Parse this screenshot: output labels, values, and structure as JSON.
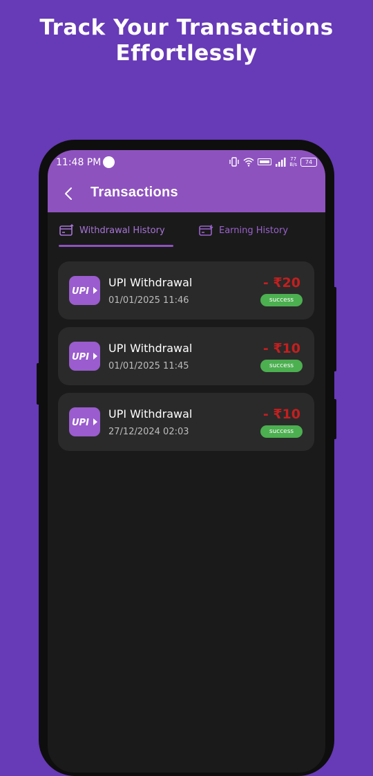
{
  "promo": {
    "line1": "Track Your Transactions",
    "line2": "Effortlessly"
  },
  "status_bar": {
    "time": "11:48 PM",
    "data_speed_top": "77",
    "data_speed_bottom": "B/s",
    "battery": "74",
    "icons": [
      "vibrate-icon",
      "wifi-icon",
      "volte-icon",
      "signal-icon",
      "battery-icon"
    ]
  },
  "appbar": {
    "title": "Transactions",
    "back_icon": "chevron-left-icon"
  },
  "tabs": [
    {
      "label": "Withdrawal History",
      "icon": "withdraw-card-icon",
      "active": true
    },
    {
      "label": "Earning History",
      "icon": "earning-card-icon",
      "active": false
    }
  ],
  "transactions": [
    {
      "title": "UPI Withdrawal",
      "date": "01/01/2025 11:46",
      "amount": "- ₹20",
      "status": "success",
      "logo_text": "UPI"
    },
    {
      "title": "UPI Withdrawal",
      "date": "01/01/2025 11:45",
      "amount": "- ₹10",
      "status": "success",
      "logo_text": "UPI"
    },
    {
      "title": "UPI Withdrawal",
      "date": "27/12/2024 02:03",
      "amount": "- ₹10",
      "status": "success",
      "logo_text": "UPI"
    }
  ],
  "colors": {
    "background": "#673AB7",
    "appbar": "#8E52BF",
    "screen": "#1a1a1a",
    "card": "#2a2a2a",
    "amount": "#c41f1f",
    "success": "#4CAF50"
  }
}
